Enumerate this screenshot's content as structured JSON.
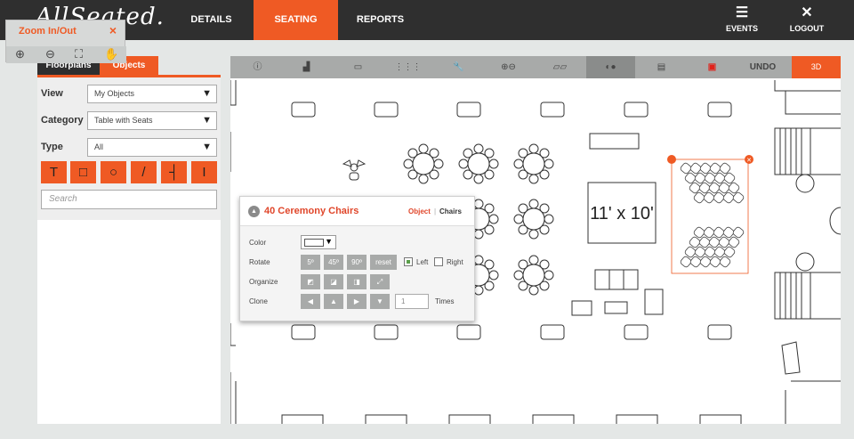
{
  "app": {
    "logo": "AllSeated.",
    "nav": [
      "DETAILS",
      "SEATING",
      "REPORTS"
    ],
    "active_nav": "SEATING",
    "events_label": "EVENTS",
    "logout_label": "LOGOUT",
    "accent_color": "#ef5a24"
  },
  "zoom_popup": {
    "title": "Zoom In/Out",
    "close": "×",
    "tools": [
      "zoom-in-icon",
      "zoom-out-icon",
      "fit-screen-icon",
      "pan-hand-icon"
    ]
  },
  "sidebar": {
    "tabs": [
      "Floorplans",
      "Objects"
    ],
    "active_tab": "Objects",
    "view_label": "View",
    "view_value": "My Objects",
    "category_label": "Category",
    "category_value": "Table with Seats",
    "type_label": "Type",
    "type_value": "All",
    "shape_tools": [
      "T",
      "□",
      "○",
      "/",
      "┤",
      "I"
    ],
    "search_placeholder": "Search"
  },
  "toolbar": {
    "items": [
      "info-icon",
      "layout-icon",
      "ruler-icon",
      "grid-icon",
      "wrench-icon",
      "zoom-icon",
      "numbering-icon",
      "toggle-icon",
      "print-icon",
      "pdf-icon"
    ],
    "undo_label": "UNDO",
    "view_3d_label": "3D"
  },
  "dialog": {
    "title": "40 Ceremony Chairs",
    "object_tab": "Object",
    "chairs_tab": "Chairs",
    "color_label": "Color",
    "rotate_label": "Rotate",
    "rotate_buttons": [
      "5º",
      "45º",
      "90º",
      "reset"
    ],
    "left_label": "Left",
    "right_label": "Right",
    "organize_label": "Organize",
    "clone_label": "Clone",
    "clone_count": "1",
    "times_label": "Times"
  },
  "canvas": {
    "dance_floor_label": "11' x 10'"
  }
}
